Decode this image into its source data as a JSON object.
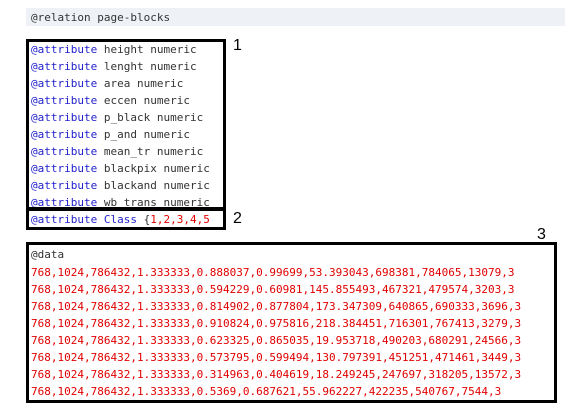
{
  "relation_line": "@relation page-blocks",
  "attributes": [
    {
      "keyword": "@attribute",
      "rest": " height numeric"
    },
    {
      "keyword": "@attribute",
      "rest": " lenght numeric"
    },
    {
      "keyword": "@attribute",
      "rest": " area numeric"
    },
    {
      "keyword": "@attribute",
      "rest": " eccen numeric"
    },
    {
      "keyword": "@attribute",
      "rest": " p_black numeric"
    },
    {
      "keyword": "@attribute",
      "rest": " p_and numeric"
    },
    {
      "keyword": "@attribute",
      "rest": " mean_tr numeric"
    },
    {
      "keyword": "@attribute",
      "rest": " blackpix numeric"
    },
    {
      "keyword": "@attribute",
      "rest": " blackand numeric"
    },
    {
      "keyword": "@attribute",
      "rest": " wb_trans numeric"
    }
  ],
  "class_attribute": {
    "keyword": "@attribute Class",
    "open": " {",
    "values": "1,2,3,4,5"
  },
  "data_keyword": "@data",
  "data_rows": [
    "768,1024,786432,1.333333,0.888037,0.99699,53.393043,698381,784065,13079,3",
    "768,1024,786432,1.333333,0.594229,0.60981,145.855493,467321,479574,3203,3",
    "768,1024,786432,1.333333,0.814902,0.877804,173.347309,640865,690333,3696,3",
    "768,1024,786432,1.333333,0.910824,0.975816,218.384451,716301,767413,3279,3",
    "768,1024,786432,1.333333,0.623325,0.865035,19.953718,490203,680291,24566,3",
    "768,1024,786432,1.333333,0.573795,0.599494,130.797391,451251,471461,3449,3",
    "768,1024,786432,1.333333,0.314963,0.404619,18.249245,247697,318205,13572,3",
    "768,1024,786432,1.333333,0.5369,0.687621,55.962227,422235,540767,7544,3"
  ],
  "annotations": [
    "1",
    "2",
    "3"
  ]
}
